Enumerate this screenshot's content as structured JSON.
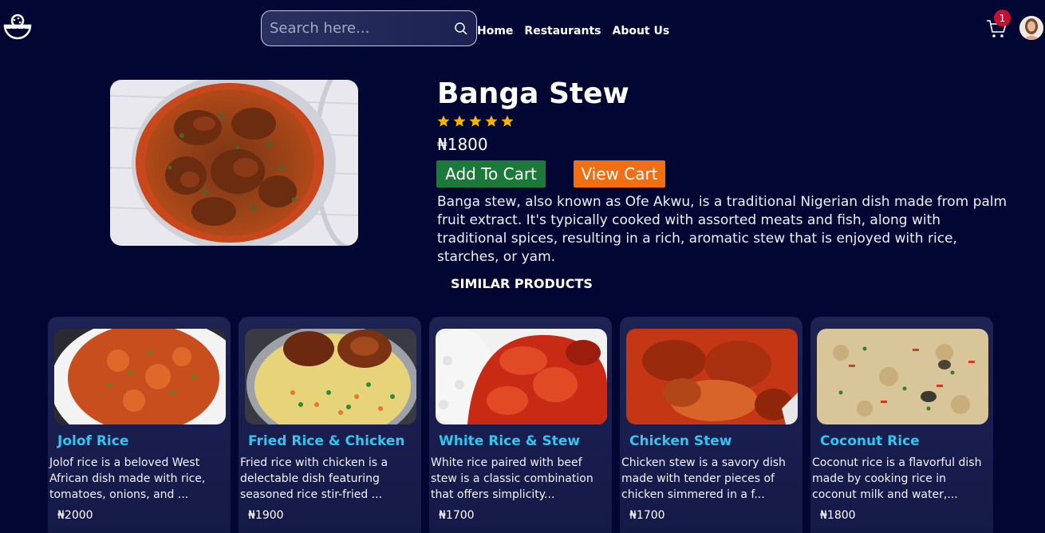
{
  "header": {
    "search_placeholder": "Search here...",
    "nav": [
      "Home",
      "Restaurants",
      "About Us"
    ],
    "cart_count": "1"
  },
  "product": {
    "name": "Banga Stew",
    "rating": 5,
    "price": "₦1800",
    "add_to_cart": "Add To Cart",
    "view_cart": "View Cart",
    "description": "Banga stew, also known as Ofe Akwu, is a traditional Nigerian dish made from palm fruit extract. It's typically cooked with assorted meats and fish, along with traditional spices, resulting in a rich, aromatic stew that is enjoyed with rice, starches, or yam."
  },
  "similar": {
    "title": "SIMILAR PRODUCTS",
    "items": [
      {
        "name": "Jolof Rice",
        "desc": "Jolof rice is a beloved West African dish made with rice, tomatoes, onions, and ...",
        "price": "₦2000"
      },
      {
        "name": "Fried Rice & Chicken",
        "desc": "Fried rice with chicken is a delectable dish featuring seasoned rice stir-fried ...",
        "price": "₦1900"
      },
      {
        "name": "White Rice & Stew",
        "desc": "White rice paired with beef stew is a classic combination that offers simplicity...",
        "price": "₦1700"
      },
      {
        "name": "Chicken Stew",
        "desc": "Chicken stew is a savory dish made with tender pieces of chicken simmered in a f...",
        "price": "₦1700"
      },
      {
        "name": "Coconut Rice",
        "desc": "Coconut rice is a flavorful dish made by cooking rice in coconut milk and water,...",
        "price": "₦1800"
      }
    ]
  },
  "colors": {
    "background": "#020633",
    "accent_cyan": "#2fc6ef",
    "add_button": "#1b7a3a",
    "view_button": "#f16e13",
    "star": "#f5b400",
    "badge": "#c8102e"
  }
}
